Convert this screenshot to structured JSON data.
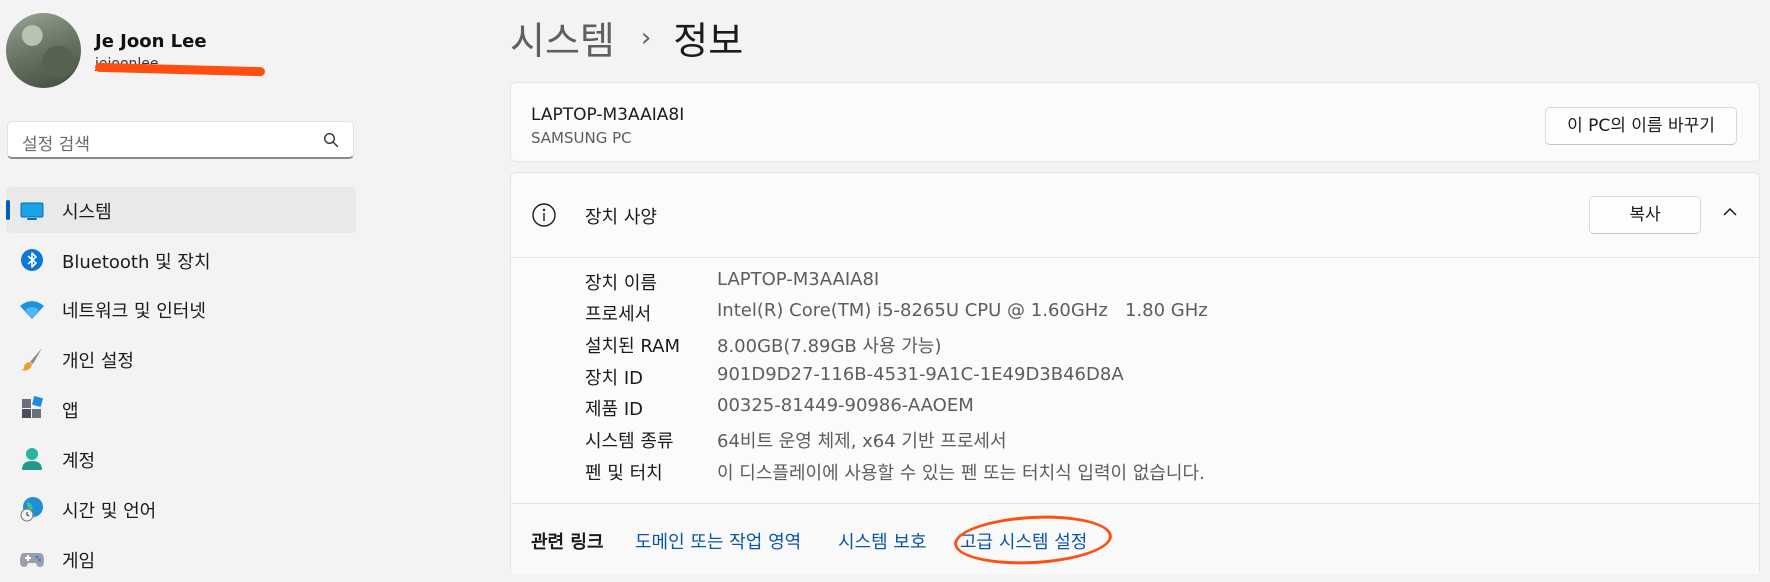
{
  "profile": {
    "name": "Je Joon Lee",
    "email_partial": "jejoonlee"
  },
  "search": {
    "placeholder": "설정 검색"
  },
  "sidebar": {
    "items": [
      {
        "label": "시스템",
        "icon": "system-icon",
        "active": true
      },
      {
        "label": "Bluetooth 및 장치",
        "icon": "bluetooth-icon"
      },
      {
        "label": "네트워크 및 인터넷",
        "icon": "wifi-icon"
      },
      {
        "label": "개인 설정",
        "icon": "brush-icon"
      },
      {
        "label": "앱",
        "icon": "apps-icon"
      },
      {
        "label": "계정",
        "icon": "account-icon"
      },
      {
        "label": "시간 및 언어",
        "icon": "globe-clock-icon"
      },
      {
        "label": "게임",
        "icon": "gamepad-icon"
      }
    ]
  },
  "breadcrumb": {
    "parent": "시스템",
    "separator": "›",
    "current": "정보"
  },
  "pc": {
    "name": "LAPTOP-M3AAIA8I",
    "model": "SAMSUNG PC",
    "rename_label": "이 PC의 이름 바꾸기"
  },
  "device_specs": {
    "title": "장치 사양",
    "copy_label": "복사",
    "rows": [
      {
        "key": "장치 이름",
        "value": "LAPTOP-M3AAIA8I"
      },
      {
        "key": "프로세서",
        "value": "Intel(R) Core(TM) i5-8265U CPU @ 1.60GHz   1.80 GHz"
      },
      {
        "key": "설치된 RAM",
        "value": "8.00GB(7.89GB 사용 가능)"
      },
      {
        "key": "장치 ID",
        "value": "901D9D27-116B-4531-9A1C-1E49D3B46D8A"
      },
      {
        "key": "제품 ID",
        "value": "00325-81449-90986-AAOEM"
      },
      {
        "key": "시스템 종류",
        "value": "64비트 운영 체제, x64 기반 프로세서"
      },
      {
        "key": "펜 및 터치",
        "value": "이 디스플레이에 사용할 수 있는 펜 또는 터치식 입력이 없습니다."
      }
    ]
  },
  "related": {
    "title": "관련 링크",
    "links": [
      "도메인 또는 작업 영역",
      "시스템 보호",
      "고급 시스템 설정"
    ]
  },
  "colors": {
    "accent": "#005fb8",
    "link": "#0a55ad",
    "annotation": "#ff4f0f"
  }
}
